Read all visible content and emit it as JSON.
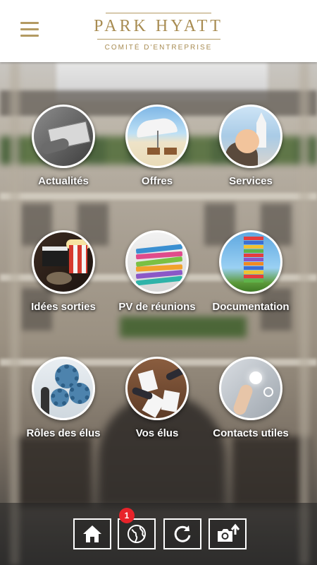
{
  "header": {
    "brand_name": "PARK HYATT",
    "brand_subtitle": "COMITÉ D'ENTREPRISE",
    "brand_color": "#a88c52"
  },
  "menu": {
    "icon": "hamburger-menu-icon"
  },
  "tiles": [
    {
      "label": "Actualités",
      "image": "newspaper-photo"
    },
    {
      "label": "Offres",
      "image": "beach-umbrella-photo"
    },
    {
      "label": "Services",
      "image": "family-castle-photo"
    },
    {
      "label": "Idées sorties",
      "image": "cinema-popcorn-photo"
    },
    {
      "label": "PV de réunions",
      "image": "stacked-binders-photo"
    },
    {
      "label": "Documentation",
      "image": "book-tower-photo"
    },
    {
      "label": "Rôles des élus",
      "image": "gears-people-photo"
    },
    {
      "label": "Vos élus",
      "image": "meeting-table-photo"
    },
    {
      "label": "Contacts utiles",
      "image": "touch-contact-photo"
    }
  ],
  "bottom_bar": {
    "buttons": [
      {
        "icon": "home-icon"
      },
      {
        "icon": "globe-icon",
        "badge": "1"
      },
      {
        "icon": "refresh-icon"
      },
      {
        "icon": "camera-upload-icon"
      }
    ],
    "badge_color": "#e8232a"
  }
}
